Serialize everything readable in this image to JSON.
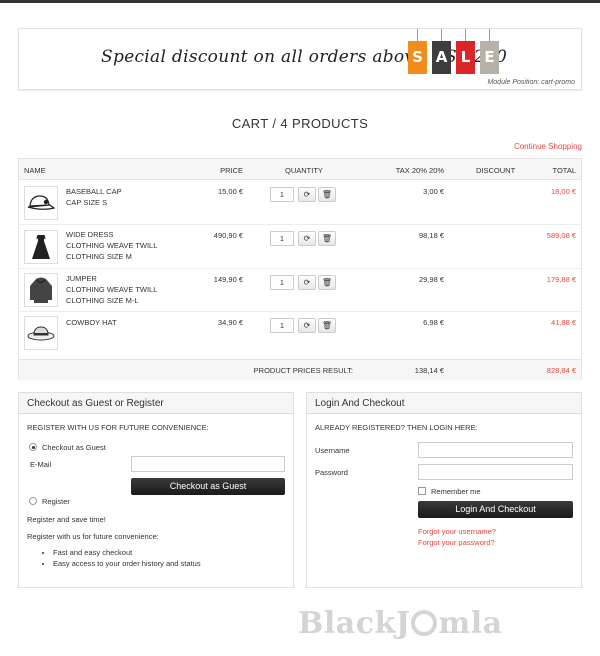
{
  "promo": {
    "text": "Special discount on all orders above US$ 250",
    "sale_letters": [
      "S",
      "A",
      "L",
      "E"
    ],
    "sale_colors": [
      "#f28c1c",
      "#3d3d3d",
      "#d8262b",
      "#b6b2a8"
    ],
    "module_position": "Module Position: cart-promo"
  },
  "cart": {
    "title": "CART / 4 PRODUCTS",
    "continue_link": "Continue Shopping",
    "headers": {
      "name": "NAME",
      "price": "PRICE",
      "quantity": "QUANTITY",
      "tax": "TAX 20% 20%",
      "discount": "DISCOUNT",
      "total": "TOTAL"
    },
    "items": [
      {
        "icon": "baseball-cap-icon",
        "line1": "BASEBALL CAP",
        "line2": "CAP SIZE S",
        "line3": "",
        "price": "15,00 €",
        "qty": "1",
        "tax": "3,00 €",
        "total": "18,00 €"
      },
      {
        "icon": "dress-icon",
        "line1": "WIDE DRESS",
        "line2": "CLOTHING WEAVE TWILL",
        "line3": "CLOTHING SIZE M",
        "price": "490,90 €",
        "qty": "1",
        "tax": "98,18 €",
        "total": "589,08 €"
      },
      {
        "icon": "jumper-icon",
        "line1": "JUMPER",
        "line2": "CLOTHING WEAVE TWILL",
        "line3": "CLOTHING SIZE M-L",
        "price": "149,90 €",
        "qty": "1",
        "tax": "29,98 €",
        "total": "179,88 €"
      },
      {
        "icon": "cowboy-hat-icon",
        "line1": "COWBOY HAT",
        "line2": "",
        "line3": "",
        "price": "34,90 €",
        "qty": "1",
        "tax": "6,98 €",
        "total": "41,88 €"
      }
    ],
    "result_label": "PRODUCT PRICES RESULT:",
    "result_tax": "138,14 €",
    "result_total": "828,84 €"
  },
  "guest": {
    "title": "Checkout as Guest or Register",
    "subtitle": "REGISTER WITH US FOR FUTURE CONVENIENCE:",
    "guest_radio": "Checkout as Guest",
    "email_label": "E-Mail",
    "email_value": "",
    "guest_button": "Checkout as Guest",
    "register_radio": "Register",
    "save_time": "Register and save time!",
    "convenience": "Register with us for future convenience:",
    "bullets": [
      "Fast and easy checkout",
      "Easy access to your order history and status"
    ]
  },
  "login": {
    "title": "Login And Checkout",
    "subtitle": "ALREADY REGISTERED? THEN LOGIN HERE:",
    "username_label": "Username",
    "username_value": "",
    "password_label": "Password",
    "password_value": "",
    "remember": "Remember me",
    "button": "Login And Checkout",
    "forgot_user": "Forgot your username?",
    "forgot_pass": "Forgot your password?"
  },
  "watermark": {
    "left": "BlackJ",
    "right": "mla"
  }
}
